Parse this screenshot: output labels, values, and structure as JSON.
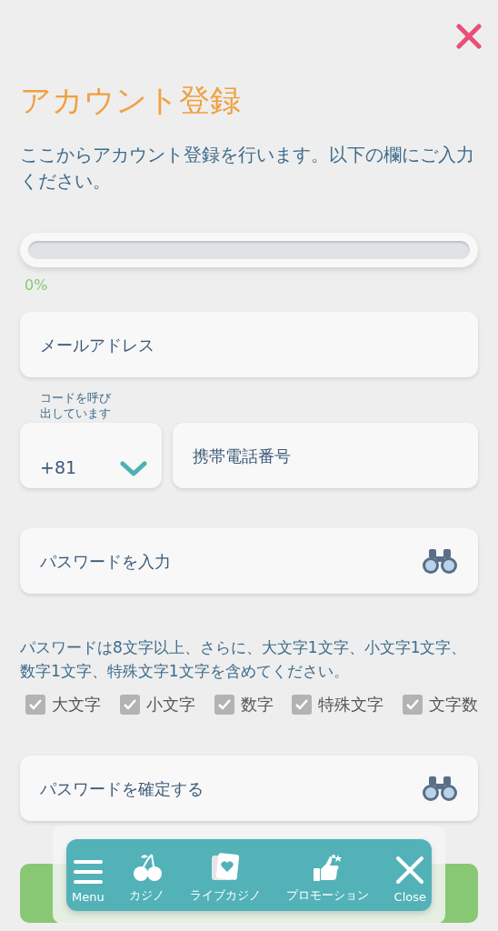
{
  "title": "アカウント登録",
  "description": "ここからアカウント登録を行います。以下の欄にご入力ください。",
  "progress": {
    "level": 0,
    "reading": "0%"
  },
  "email_field": {
    "placeholder": "メールアドレス"
  },
  "country_code": {
    "label": "コードを呼び出しています",
    "value": "+81"
  },
  "phone_field": {
    "placeholder": "携帯電話番号"
  },
  "password_field": {
    "placeholder": "パスワードを入力"
  },
  "password_rules": "パスワードは8文字以上、さらに、大文字1文字、小文字1文字、数字1文字、特殊文字1文字を含めてください。",
  "checks": [
    {
      "label": "大文字",
      "checked": true
    },
    {
      "label": "小文字",
      "checked": true
    },
    {
      "label": "数字",
      "checked": true
    },
    {
      "label": "特殊文字",
      "checked": true
    },
    {
      "label": "文字数",
      "checked": true
    }
  ],
  "confirm_field": {
    "placeholder": "パスワードを確定する"
  },
  "bottom_nav": [
    {
      "kind": "menu",
      "label": "Menu"
    },
    {
      "kind": "cherry",
      "label": "カジノ"
    },
    {
      "kind": "cards",
      "label": "ライブカジノ"
    },
    {
      "kind": "promo",
      "label": "プロモーション"
    },
    {
      "kind": "close",
      "label": "Close"
    }
  ]
}
